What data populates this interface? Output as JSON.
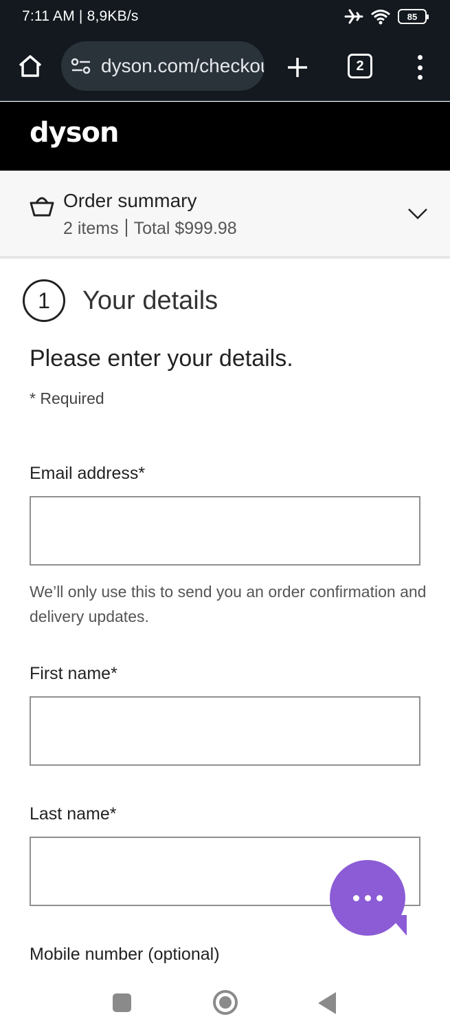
{
  "status_bar": {
    "time": "7:11 AM | 8,9KB/s",
    "battery": "85",
    "icons": [
      "airplane-icon",
      "wifi-icon",
      "battery-icon"
    ]
  },
  "browser": {
    "url": "dyson.com/checkout",
    "tab_count": "2",
    "icons": [
      "home-icon",
      "site-settings-icon",
      "plus-icon",
      "tabs-icon",
      "more-vert-icon"
    ]
  },
  "site": {
    "logo": "dyson"
  },
  "order_summary": {
    "title": "Order summary",
    "items": "2 items",
    "total": "Total $999.98",
    "icons": [
      "basket-icon",
      "chevron-down-icon"
    ]
  },
  "step": {
    "number": "1",
    "title": "Your details"
  },
  "form": {
    "intro": "Please enter your details.",
    "required_note": "* Required",
    "email": {
      "label": "Email address*",
      "value": "",
      "helper": "We’ll only use this to send you an order confirmation and delivery updates."
    },
    "first_name": {
      "label": "First name*",
      "value": ""
    },
    "last_name": {
      "label": "Last name*",
      "value": ""
    },
    "mobile": {
      "label": "Mobile number (optional)"
    }
  },
  "colors": {
    "header_bg": "#000000",
    "browser_bg": "#13191f",
    "chat_accent": "#8b5cd6"
  },
  "chat": {
    "icon": "chat-bubble-icon"
  },
  "nav": {
    "icons": [
      "recents-icon",
      "home-circle-icon",
      "back-icon"
    ]
  }
}
